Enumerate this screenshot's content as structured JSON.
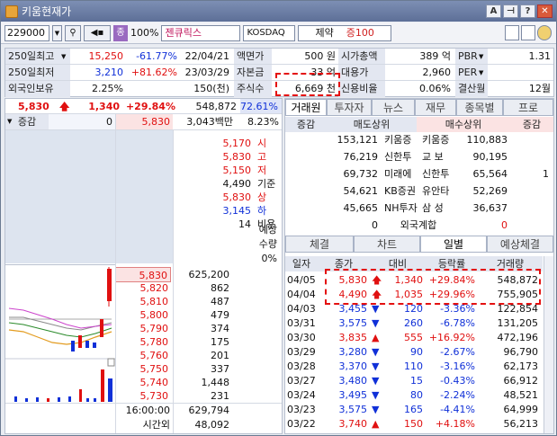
{
  "window": {
    "title": "키움현재가"
  },
  "toolbar": {
    "code": "229000",
    "sound_label": "◀▪",
    "order_glyph": "종",
    "percent": "100%",
    "stock_name": "젠큐릭스",
    "market": "KOSDAQ",
    "sector_a": "제약",
    "sector_b": "증100"
  },
  "info": {
    "row1": {
      "label": "250일최고",
      "value": "15,250",
      "pct": "-61.77%",
      "date": "22/04/21",
      "face_label": "액면가",
      "face_value": "500 원",
      "mcap_label": "시가총액",
      "mcap_value": "389 억",
      "per_label": "PBR",
      "per_value": "1.31"
    },
    "row2": {
      "label": "250일최저",
      "value": "3,210",
      "pct": "+81.62%",
      "date": "23/03/29",
      "cap_label": "자본금",
      "cap_value": "33 억",
      "sub_label": "대용가",
      "sub_value": "2,960",
      "per_label": "PER",
      "per_value": ""
    },
    "row3": {
      "label": "외국인보유",
      "value": "2.25%",
      "shares": "150(천)",
      "shares_label": "주식수",
      "shares_value": "6,669 천",
      "credit_label": "신용비율",
      "credit_value": "0.06%",
      "settle_label": "결산월",
      "settle_value": "12월"
    }
  },
  "quote": {
    "price": "5,830",
    "change": "1,340",
    "change_pct": "+29.84%",
    "volume": "548,872",
    "vol_ratio": "72.61%",
    "side_label": "증감",
    "side_value": "0",
    "bid_price": "5,830",
    "amount": "3,043백만",
    "amount_pct": "8.23%"
  },
  "summary": [
    {
      "value": "5,170",
      "label": "시",
      "color": "#e01010"
    },
    {
      "value": "5,830",
      "label": "고",
      "color": "#e01010"
    },
    {
      "value": "5,150",
      "label": "저",
      "color": "#e01010"
    },
    {
      "value": "4,490",
      "label": "기준",
      "color": "#111111"
    },
    {
      "value": "5,830",
      "label": "상",
      "color": "#e01010"
    },
    {
      "value": "3,145",
      "label": "하",
      "color": "#1030d8"
    },
    {
      "value": "14",
      "label": "비용",
      "color": "#111111"
    }
  ],
  "expected": {
    "label1": "예상",
    "label2": "수량",
    "value": "0%"
  },
  "asks": [
    {
      "price": "5,830",
      "qty": "625,200"
    },
    {
      "price": "5,820",
      "qty": "862"
    },
    {
      "price": "5,810",
      "qty": "487"
    },
    {
      "price": "5,800",
      "qty": "479"
    },
    {
      "price": "5,790",
      "qty": "374"
    },
    {
      "price": "5,780",
      "qty": "175"
    },
    {
      "price": "5,760",
      "qty": "201"
    },
    {
      "price": "5,750",
      "qty": "337"
    },
    {
      "price": "5,740",
      "qty": "1,448"
    },
    {
      "price": "5,730",
      "qty": "231"
    }
  ],
  "footer": {
    "time": "16:00:00",
    "total": "629,794",
    "after_label": "시간외",
    "after_value": "48,092"
  },
  "right_tabs": [
    "거래원",
    "투자자",
    "뉴스",
    "재무",
    "종목별",
    "프로"
  ],
  "broker": {
    "headers": {
      "change": "증감",
      "sell": "매도상위",
      "buy": "매수상위",
      "change2": "증감"
    },
    "rows": [
      {
        "sell_qty": "153,121",
        "sell_name": "키움증",
        "buy_name": "키움증",
        "buy_qty": "110,883",
        "change": ""
      },
      {
        "sell_qty": "76,219",
        "sell_name": "신한투",
        "buy_name": "교 보",
        "buy_qty": "90,195",
        "change": ""
      },
      {
        "sell_qty": "69,732",
        "sell_name": "미래에",
        "buy_name": "신한투",
        "buy_qty": "65,564",
        "change": "1"
      },
      {
        "sell_qty": "54,621",
        "sell_name": "KB증권",
        "buy_name": "유안타",
        "buy_qty": "52,269",
        "change": ""
      },
      {
        "sell_qty": "45,665",
        "sell_name": "NH투자",
        "buy_name": "삼 성",
        "buy_qty": "36,637",
        "change": ""
      }
    ],
    "foreign": {
      "sell": "0",
      "label": "외국계합",
      "buy": "0"
    }
  },
  "sub_tabs": [
    "체결",
    "차트",
    "일별",
    "예상체결"
  ],
  "daily_headers": [
    "일자",
    "종가",
    "대비",
    "등락률",
    "거래량"
  ],
  "daily": [
    {
      "date": "04/05",
      "close": "5,830",
      "dir": "limitup",
      "diff": "1,340",
      "rate": "+29.84%",
      "vol": "548,872"
    },
    {
      "date": "04/04",
      "close": "4,490",
      "dir": "limitup",
      "diff": "1,035",
      "rate": "+29.96%",
      "vol": "755,905"
    },
    {
      "date": "04/03",
      "close": "3,455",
      "dir": "down",
      "diff": "120",
      "rate": "-3.36%",
      "vol": "122,854"
    },
    {
      "date": "03/31",
      "close": "3,575",
      "dir": "down",
      "diff": "260",
      "rate": "-6.78%",
      "vol": "131,205"
    },
    {
      "date": "03/30",
      "close": "3,835",
      "dir": "up",
      "diff": "555",
      "rate": "+16.92%",
      "vol": "472,196"
    },
    {
      "date": "03/29",
      "close": "3,280",
      "dir": "down",
      "diff": "90",
      "rate": "-2.67%",
      "vol": "96,790"
    },
    {
      "date": "03/28",
      "close": "3,370",
      "dir": "down",
      "diff": "110",
      "rate": "-3.16%",
      "vol": "62,173"
    },
    {
      "date": "03/27",
      "close": "3,480",
      "dir": "down",
      "diff": "15",
      "rate": "-0.43%",
      "vol": "66,912"
    },
    {
      "date": "03/24",
      "close": "3,495",
      "dir": "down",
      "diff": "80",
      "rate": "-2.24%",
      "vol": "48,521"
    },
    {
      "date": "03/23",
      "close": "3,575",
      "dir": "down",
      "diff": "165",
      "rate": "-4.41%",
      "vol": "64,999"
    },
    {
      "date": "03/22",
      "close": "3,740",
      "dir": "up",
      "diff": "150",
      "rate": "+4.18%",
      "vol": "56,213"
    }
  ],
  "colors": {
    "up": "#e01010",
    "down": "#1030d8",
    "highlight": "#e41010"
  }
}
